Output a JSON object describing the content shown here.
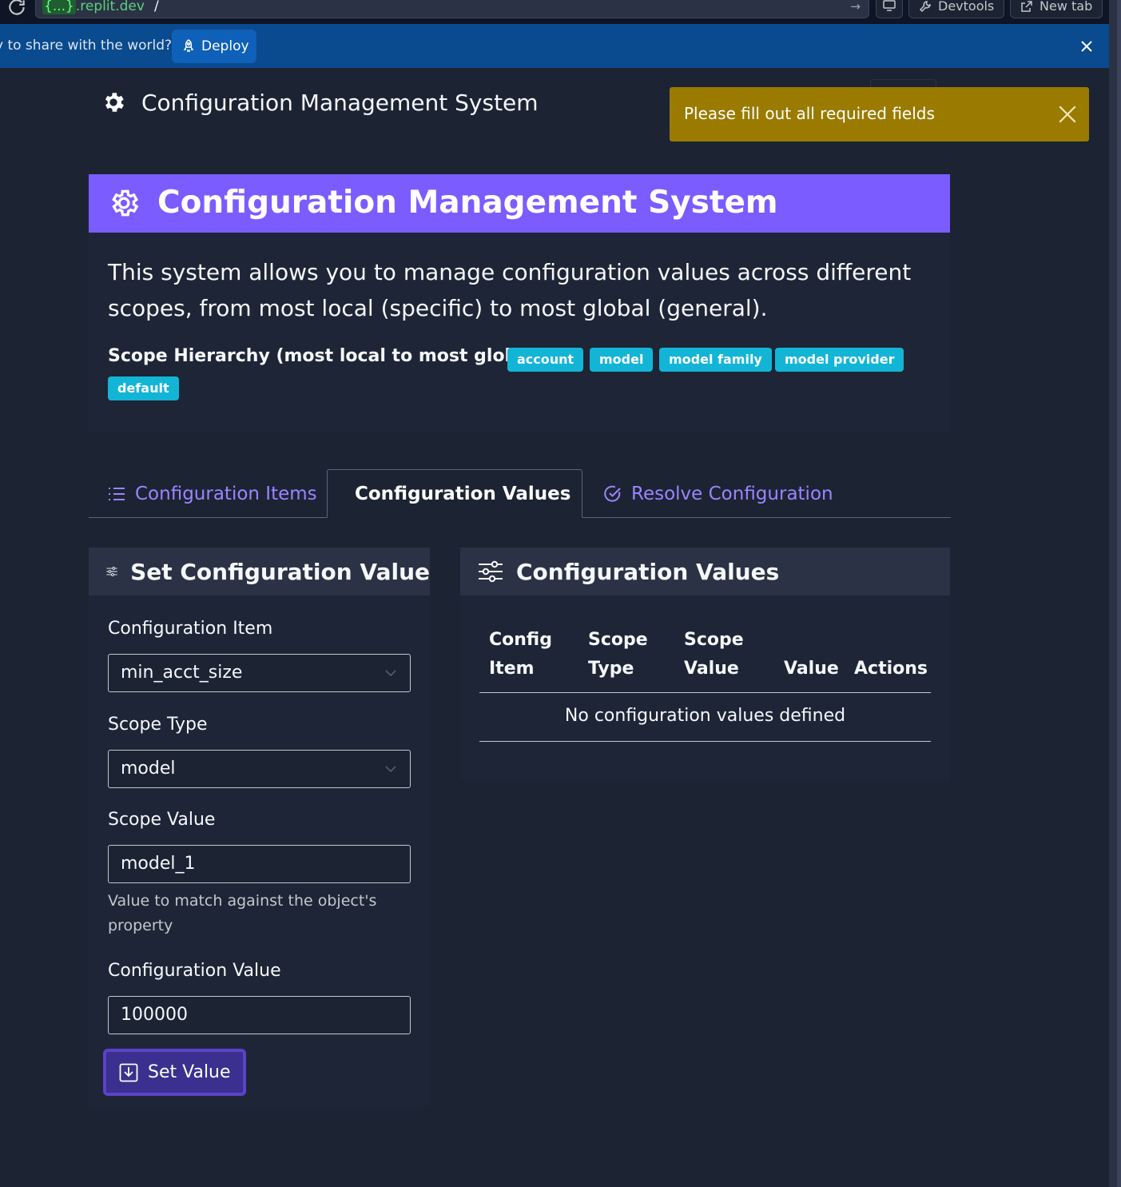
{
  "browser": {
    "url_host_brace": "{...}",
    "url_host": ".replit.dev",
    "url_path": "/",
    "devtools_label": "Devtools",
    "new_tab_label": "New tab"
  },
  "banner": {
    "text": "y to share with the world?",
    "deploy_label": "Deploy"
  },
  "header": {
    "title": "Configuration Management System"
  },
  "toast": {
    "message": "Please fill out all required fields"
  },
  "card": {
    "title": "Configuration Management System",
    "intro": "This system allows you to manage configuration values across different scopes, from most local (specific) to most global (general).",
    "hierarchy_label": "Scope Hierarchy (most local to most global):",
    "scopes": [
      "account",
      "model",
      "model family",
      "model provider",
      "default"
    ]
  },
  "tabs": [
    {
      "label": "Configuration Items",
      "active": false
    },
    {
      "label": "Configuration Values",
      "active": true
    },
    {
      "label": "Resolve Configuration",
      "active": false
    }
  ],
  "set_form": {
    "title": "Set Configuration Value",
    "item_label": "Configuration Item",
    "item_value": "min_acct_size",
    "scope_type_label": "Scope Type",
    "scope_type_value": "model",
    "scope_value_label": "Scope Value",
    "scope_value_value": "model_1",
    "scope_value_help": "Value to match against the object's property",
    "config_value_label": "Configuration Value",
    "config_value_value": "100000",
    "submit_label": "Set Value"
  },
  "values_panel": {
    "title": "Configuration Values",
    "columns": [
      {
        "line1": "Config",
        "line2": "Item"
      },
      {
        "line1": "Scope",
        "line2": "Type"
      },
      {
        "line1": "Scope",
        "line2": "Value"
      },
      {
        "line1": "",
        "line2": "Value"
      },
      {
        "line1": "",
        "line2": "Actions"
      }
    ],
    "empty_message": "No configuration values defined"
  },
  "colors": {
    "background": "#1c2333",
    "accent": "#7b5cff",
    "toast_warning": "#9a7b00",
    "badge": "#12b5d6",
    "banner": "#0a4a8f"
  }
}
